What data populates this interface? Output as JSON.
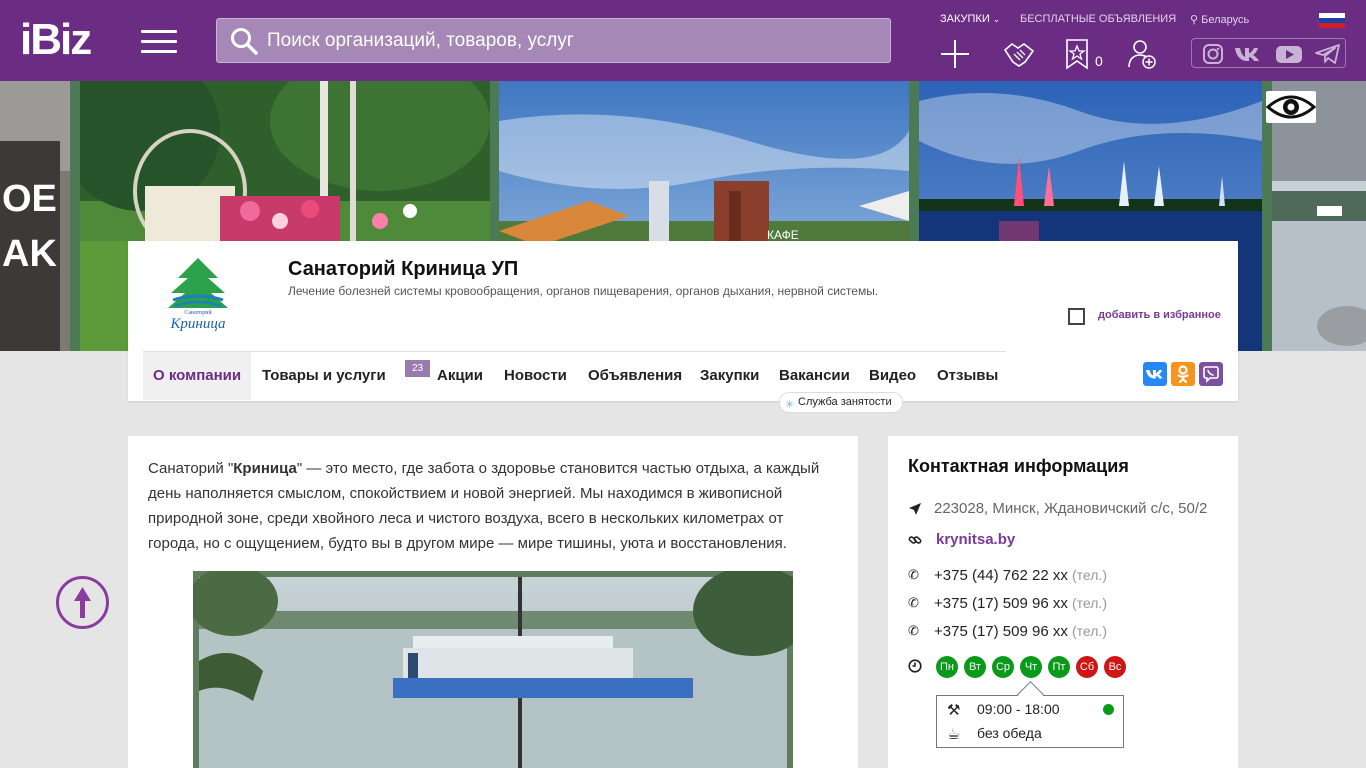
{
  "header": {
    "logo": "iBiz",
    "search_placeholder": "Поиск организаций, товаров, услуг",
    "links": {
      "purchases": "ЗАКУПКИ",
      "free_ads": "БЕСПЛАТНЫЕ ОБЪЯВЛЕНИЯ",
      "region": "Беларусь"
    },
    "favorites_count": "0",
    "icons": [
      "add-icon",
      "handshake-icon",
      "star-bookmark-icon",
      "add-user-icon",
      "instagram-icon",
      "vk-icon",
      "youtube-icon",
      "telegram-icon"
    ]
  },
  "company": {
    "name": "Санаторий Криница УП",
    "description": "Лечение болезней системы кровообращения, органов пищеварения, органов дыхания, нервной системы.",
    "logo_text": "Криница",
    "logo_caption": "Санаторий",
    "add_favorite": "добавить в избранное"
  },
  "nav": {
    "items": [
      {
        "label": "О компании",
        "active": true
      },
      {
        "label": "Товары и услуги"
      },
      {
        "label": "Акции"
      },
      {
        "label": "Новости"
      },
      {
        "label": "Объявления"
      },
      {
        "label": "Закупки"
      },
      {
        "label": "Вакансии"
      },
      {
        "label": "Видео"
      },
      {
        "label": "Отзывы"
      }
    ],
    "products_badge": "23",
    "employment_service": "Служба занятости"
  },
  "about": {
    "intro_before": "Санаторий \"",
    "intro_bold": "Криница",
    "intro_after": "\" — это место, где забота о здоровье становится частью отдыха, а каждый день наполняется смыслом, спокойствием и новой энергией. Мы находимся в живописной природной зоне, среди хвойного леса и чистого воздуха, всего в нескольких километрах от города, но с ощущением, будто вы в другом мире — мире тишины, уюта и восстановления."
  },
  "contacts": {
    "title": "Контактная информация",
    "address": "223028, Минск, Ждановичский с/с, 50/2",
    "website": "krynitsa.by",
    "phones": [
      {
        "number": "+375 (44) 762 22 xx",
        "type": "(тел.)"
      },
      {
        "number": "+375 (17) 509 96 xx",
        "type": "(тел.)"
      },
      {
        "number": "+375 (17) 509 96 xx",
        "type": "(тел.)"
      }
    ],
    "days": [
      {
        "label": "Пн",
        "open": true
      },
      {
        "label": "Вт",
        "open": true
      },
      {
        "label": "Ср",
        "open": true
      },
      {
        "label": "Чт",
        "open": true
      },
      {
        "label": "Пт",
        "open": true
      },
      {
        "label": "Сб",
        "open": false
      },
      {
        "label": "Вс",
        "open": false
      }
    ],
    "hours": "09:00 - 18:00",
    "lunch": "без обеда",
    "colors": {
      "open": "#0a9a1a",
      "closed": "#d01515"
    }
  },
  "colors": {
    "brand": "#6b2c84",
    "accent": "#7a3a96"
  }
}
